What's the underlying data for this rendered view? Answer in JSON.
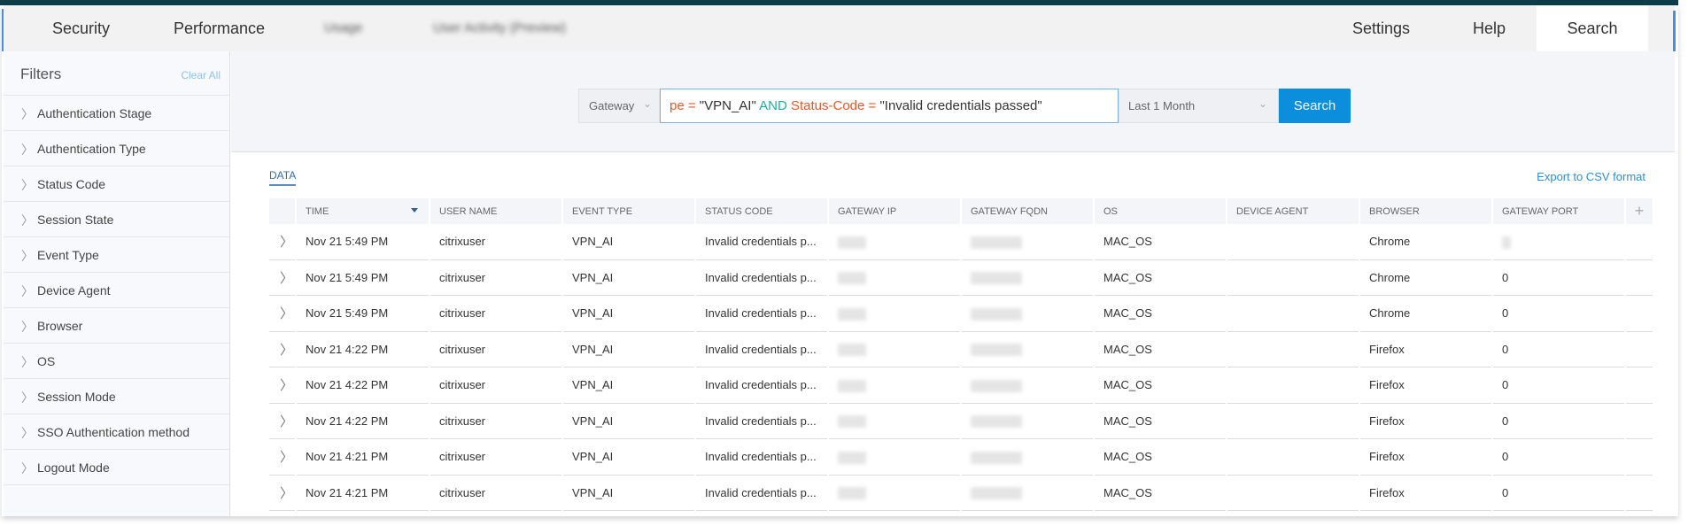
{
  "nav": {
    "items": [
      "Security",
      "Performance",
      "Usage",
      "User Activity (Preview)"
    ],
    "right": [
      "Settings",
      "Help",
      "Search"
    ],
    "active": "Search"
  },
  "sidebar": {
    "title": "Filters",
    "clear_all": "Clear All",
    "items": [
      "Authentication Stage",
      "Authentication Type",
      "Status Code",
      "Session State",
      "Event Type",
      "Device Agent",
      "Browser",
      "OS",
      "Session Mode",
      "SSO Authentication method",
      "Logout Mode"
    ]
  },
  "search": {
    "scope": "Gateway",
    "query": {
      "p1": "pe = ",
      "p2": "\"VPN_AI\" ",
      "p3": "AND ",
      "p4": "Status-Code = ",
      "p5": " \"Invalid credentials passed\""
    },
    "time_range": "Last 1 Month",
    "button": "Search"
  },
  "colors": {
    "keyword": "#1ab0a0",
    "field": "#e8572a",
    "accent": "#0b8fdc"
  },
  "data_tab": "DATA",
  "export": "Export to CSV format",
  "table": {
    "headers": [
      "TIME",
      "USER NAME",
      "EVENT TYPE",
      "STATUS CODE",
      "GATEWAY IP",
      "GATEWAY FQDN",
      "OS",
      "DEVICE AGENT",
      "BROWSER",
      "GATEWAY PORT"
    ],
    "rows": [
      {
        "time": "Nov 21 5:49 PM",
        "user": "citrixuser",
        "event": "VPN_AI",
        "status": "Invalid credentials p...",
        "os": "MAC_OS",
        "agent": "",
        "browser": "Chrome",
        "port": null
      },
      {
        "time": "Nov 21 5:49 PM",
        "user": "citrixuser",
        "event": "VPN_AI",
        "status": "Invalid credentials p...",
        "os": "MAC_OS",
        "agent": "",
        "browser": "Chrome",
        "port": "0"
      },
      {
        "time": "Nov 21 5:49 PM",
        "user": "citrixuser",
        "event": "VPN_AI",
        "status": "Invalid credentials p...",
        "os": "MAC_OS",
        "agent": "",
        "browser": "Chrome",
        "port": "0"
      },
      {
        "time": "Nov 21 4:22 PM",
        "user": "citrixuser",
        "event": "VPN_AI",
        "status": "Invalid credentials p...",
        "os": "MAC_OS",
        "agent": "",
        "browser": "Firefox",
        "port": "0"
      },
      {
        "time": "Nov 21 4:22 PM",
        "user": "citrixuser",
        "event": "VPN_AI",
        "status": "Invalid credentials p...",
        "os": "MAC_OS",
        "agent": "",
        "browser": "Firefox",
        "port": "0"
      },
      {
        "time": "Nov 21 4:22 PM",
        "user": "citrixuser",
        "event": "VPN_AI",
        "status": "Invalid credentials p...",
        "os": "MAC_OS",
        "agent": "",
        "browser": "Firefox",
        "port": "0"
      },
      {
        "time": "Nov 21 4:21 PM",
        "user": "citrixuser",
        "event": "VPN_AI",
        "status": "Invalid credentials p...",
        "os": "MAC_OS",
        "agent": "",
        "browser": "Firefox",
        "port": "0"
      },
      {
        "time": "Nov 21 4:21 PM",
        "user": "citrixuser",
        "event": "VPN_AI",
        "status": "Invalid credentials p...",
        "os": "MAC_OS",
        "agent": "",
        "browser": "Firefox",
        "port": "0"
      }
    ]
  }
}
